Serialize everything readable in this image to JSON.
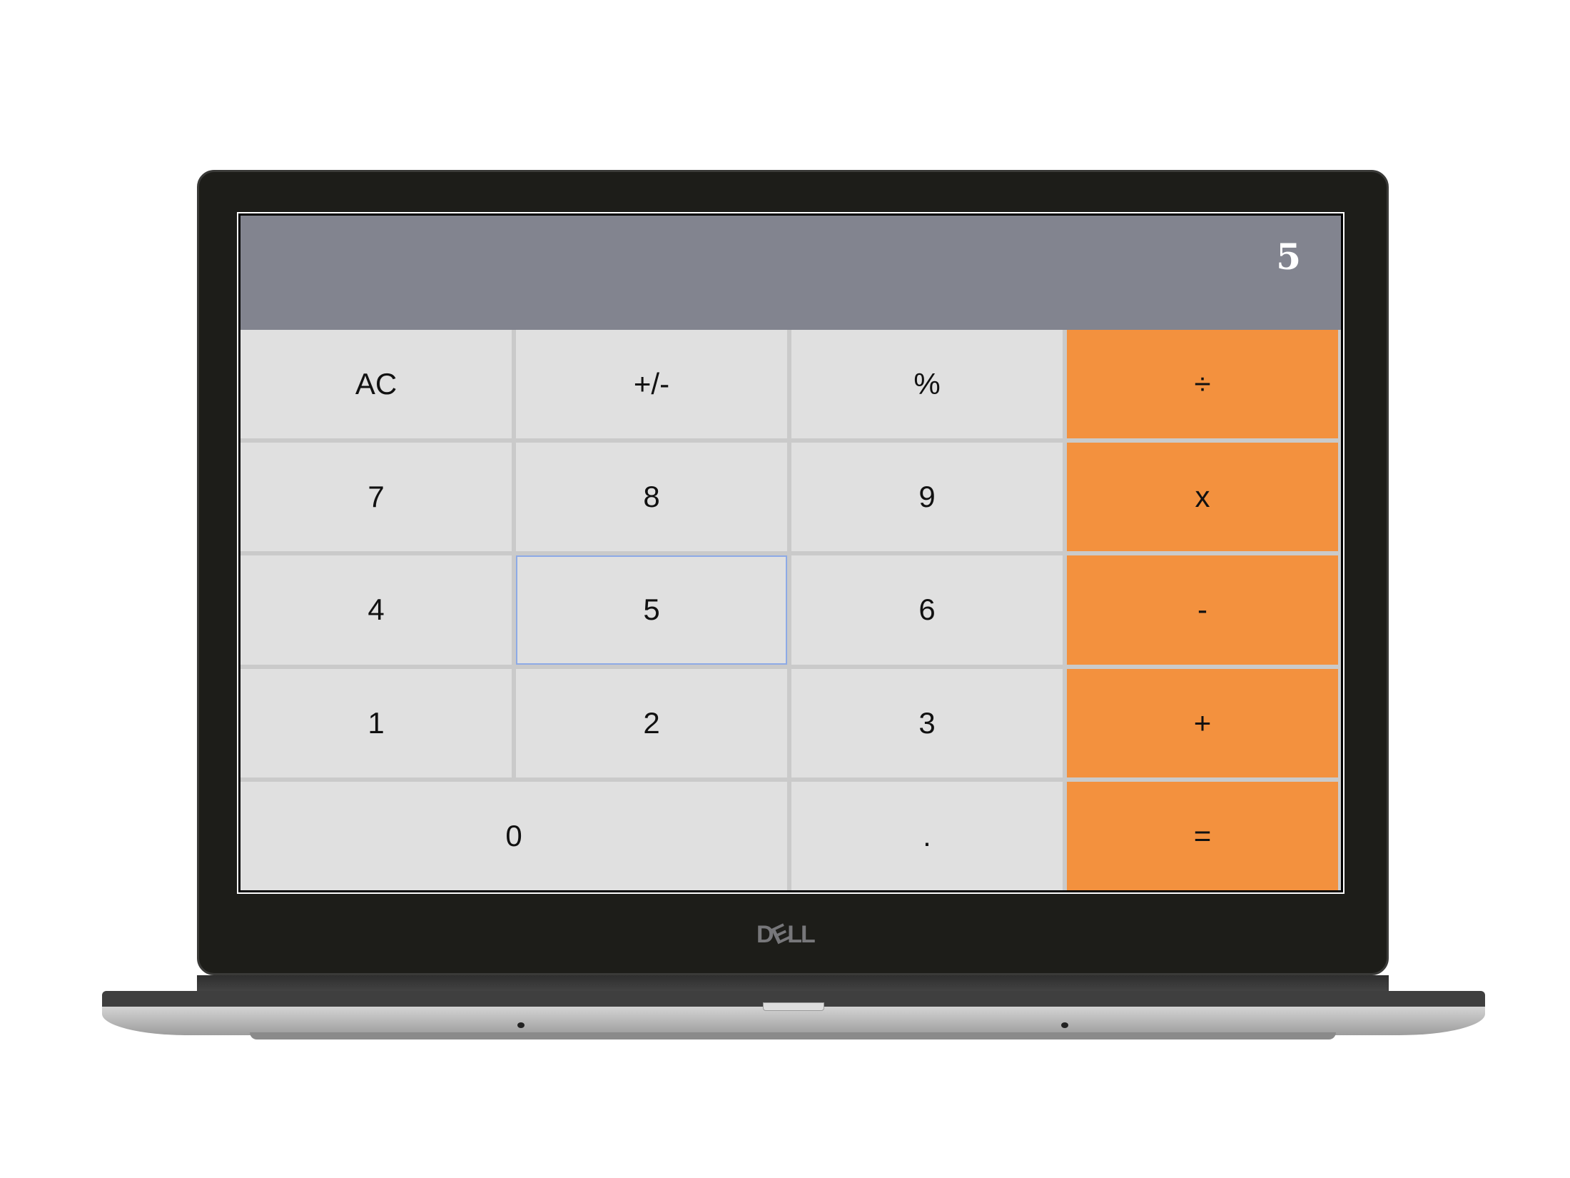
{
  "device": {
    "brand_logo": "DELL"
  },
  "calculator": {
    "display": "5",
    "keys": [
      {
        "label": "AC",
        "name": "clear-button",
        "type": "func"
      },
      {
        "label": "+/-",
        "name": "toggle-sign-button",
        "type": "func"
      },
      {
        "label": "%",
        "name": "percent-button",
        "type": "func"
      },
      {
        "label": "÷",
        "name": "divide-button",
        "type": "op"
      },
      {
        "label": "7",
        "name": "digit-7-button",
        "type": "num"
      },
      {
        "label": "8",
        "name": "digit-8-button",
        "type": "num"
      },
      {
        "label": "9",
        "name": "digit-9-button",
        "type": "num"
      },
      {
        "label": "x",
        "name": "multiply-button",
        "type": "op"
      },
      {
        "label": "4",
        "name": "digit-4-button",
        "type": "num"
      },
      {
        "label": "5",
        "name": "digit-5-button",
        "type": "num",
        "focused": true
      },
      {
        "label": "6",
        "name": "digit-6-button",
        "type": "num"
      },
      {
        "label": "-",
        "name": "subtract-button",
        "type": "op"
      },
      {
        "label": "1",
        "name": "digit-1-button",
        "type": "num"
      },
      {
        "label": "2",
        "name": "digit-2-button",
        "type": "num"
      },
      {
        "label": "3",
        "name": "digit-3-button",
        "type": "num"
      },
      {
        "label": "+",
        "name": "add-button",
        "type": "op"
      },
      {
        "label": "0",
        "name": "digit-0-button",
        "type": "num",
        "wide": true
      },
      {
        "label": ".",
        "name": "decimal-button",
        "type": "num"
      },
      {
        "label": "=",
        "name": "equals-button",
        "type": "op"
      }
    ]
  },
  "colors": {
    "operator": "#f3913e",
    "key": "#e0e0e0",
    "display_bg": "#82848f",
    "focus": "#8daae6"
  }
}
